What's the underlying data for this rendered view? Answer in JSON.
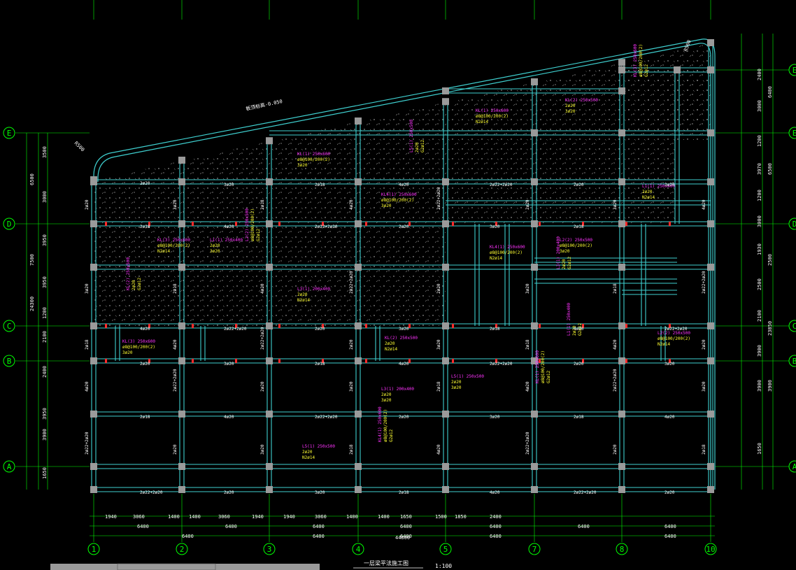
{
  "colors": {
    "background": "#000000",
    "beam": "#3fd0d0",
    "grid_axis": "#00ff00",
    "dimension": "#00ff00",
    "column": "#9a9a9a",
    "hatch": "#cfcfcf",
    "magenta_label": "#ff33ff",
    "yellow_label": "#ffff33",
    "white_label": "#ffffff",
    "red_mark": "#ff2a2a"
  },
  "axes_bottom": [
    "1",
    "2",
    "3",
    "5",
    "7",
    "8",
    "10"
  ],
  "axes_left": [
    "E",
    "D",
    "C",
    "B",
    "A"
  ],
  "axes_right": [
    "E",
    "D",
    "C",
    "B",
    "A"
  ],
  "axis_bubble_4": "4",
  "dims_bottom_row1": [
    "1940",
    "3060",
    "1400",
    "1400",
    "3060",
    "1940",
    "1940",
    "3060",
    "1400",
    "1400",
    "1650",
    "1500",
    "1850",
    "2400"
  ],
  "dims_bottom_row2": [
    "6400",
    "6400",
    "6400",
    "6400",
    "6400",
    "6400",
    "6400"
  ],
  "dims_bottom_row3": [
    "6400",
    "6400",
    "6400",
    "6400",
    "6400"
  ],
  "dims_bottom_total": "44800",
  "dims_left": [
    "3500",
    "3000",
    "3950",
    "3950",
    "1200",
    "2100",
    "2400",
    "3950",
    "3900",
    "1650"
  ],
  "dims_left_outer": [
    "6500",
    "7500",
    "24300"
  ],
  "dims_right": [
    "2400",
    "3000",
    "1200",
    "3970",
    "1200",
    "3000",
    "1930",
    "2500",
    "2100",
    "3900",
    "3900",
    "1650"
  ],
  "dims_right_outer": [
    "6400",
    "6500",
    "2500",
    "3900",
    "23850"
  ],
  "slab_note": "板顶标高-0.050",
  "radius_left": "R500",
  "radius_right": "R500",
  "drawing_title": "一层梁平法施工图",
  "drawing_scale": "1:100",
  "labels_magenta": [
    "KL(1) 250x600",
    "KL(2) 250x500",
    "KL(3) 250x600",
    "L1(1) 250x400",
    "L2(2) 250x500",
    "L3(1) 200x400",
    "KL4(1) 250x600",
    "L5(1) 250x500"
  ],
  "labels_yellow": [
    "ø8@100/200(2)",
    "2ø20",
    "3ø20",
    "G2ø12",
    "N2ø14"
  ],
  "labels_white": [
    "2ø20",
    "3ø20",
    "2ø18",
    "4ø20",
    "2ø22+2ø20"
  ]
}
